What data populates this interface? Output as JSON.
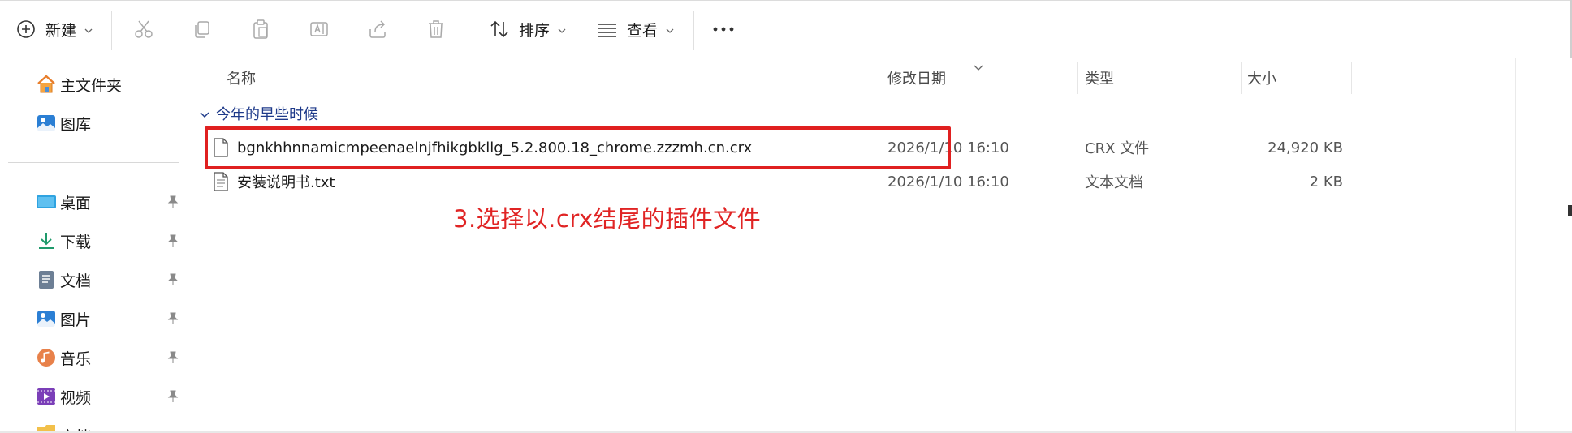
{
  "toolbar": {
    "new_label": "新建",
    "sort_label": "排序",
    "view_label": "查看",
    "more_label": "•••"
  },
  "sidebar": {
    "items": [
      {
        "label": "主文件夹",
        "icon": "home-icon"
      },
      {
        "label": "图库",
        "icon": "gallery-icon"
      },
      {
        "label": "桌面",
        "icon": "desktop-icon",
        "pinned": true
      },
      {
        "label": "下载",
        "icon": "download-icon",
        "pinned": true
      },
      {
        "label": "文档",
        "icon": "document-icon",
        "pinned": true
      },
      {
        "label": "图片",
        "icon": "pictures-icon",
        "pinned": true
      },
      {
        "label": "音乐",
        "icon": "music-icon",
        "pinned": true
      },
      {
        "label": "视频",
        "icon": "video-icon",
        "pinned": true
      },
      {
        "label": "文档",
        "icon": "folder-icon",
        "pinned": true
      }
    ]
  },
  "columns": {
    "name": "名称",
    "modified": "修改日期",
    "type": "类型",
    "size": "大小"
  },
  "group": {
    "label": "今年的早些时候"
  },
  "files": [
    {
      "name": "bgnkhhnnamicmpeenaelnjfhikgbkllg_5.2.800.18_chrome.zzzmh.cn.crx",
      "modified": "2026/1/10 16:10",
      "type": "CRX 文件",
      "size": "24,920 KB"
    },
    {
      "name": "安装说明书.txt",
      "modified": "2026/1/10 16:10",
      "type": "文本文档",
      "size": "2 KB"
    }
  ],
  "annotation": {
    "text": "3.选择以.crx结尾的插件文件",
    "color": "#e02424"
  },
  "colors": {
    "accent": "#1e3a8a",
    "highlight_border": "#e02020"
  }
}
